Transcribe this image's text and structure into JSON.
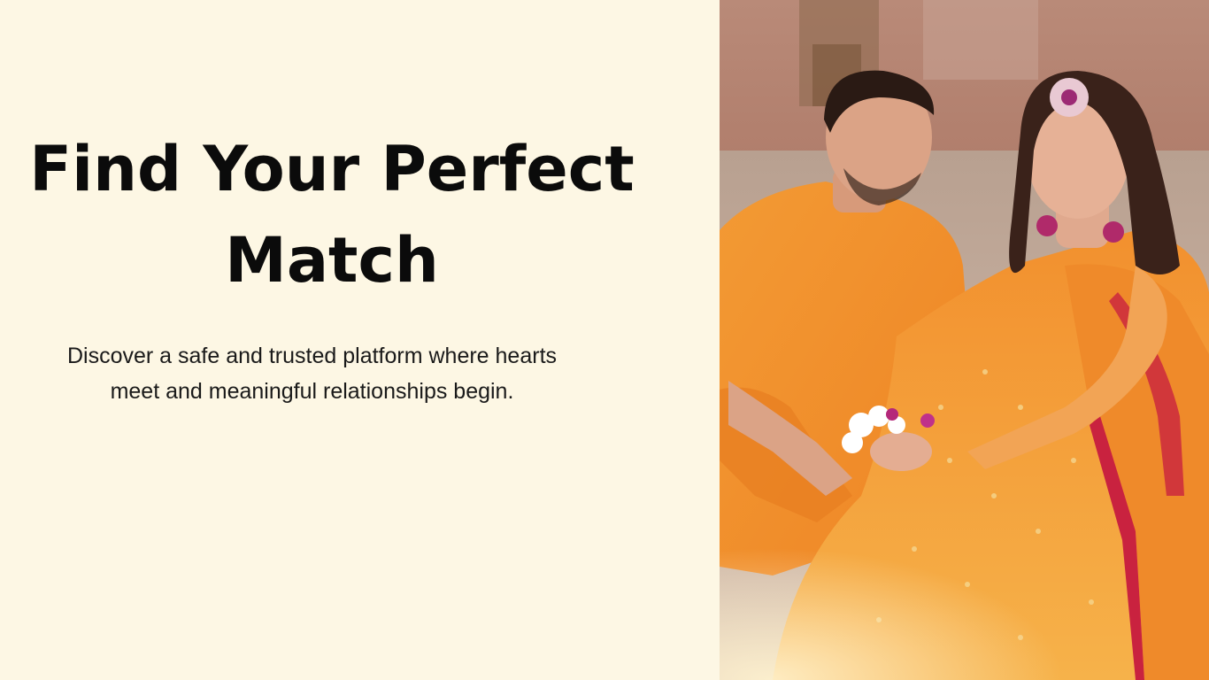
{
  "hero": {
    "title": "Find Your Perfect Match",
    "subtitle": "Discover a safe and trusted platform where hearts meet and meaningful relationships begin."
  },
  "colors": {
    "background": "#fdf7e4",
    "title": "#0b0b0b",
    "text": "#1a1a1a",
    "accent_orange": "#f0902a"
  },
  "image": {
    "subject": "couple-photo"
  }
}
